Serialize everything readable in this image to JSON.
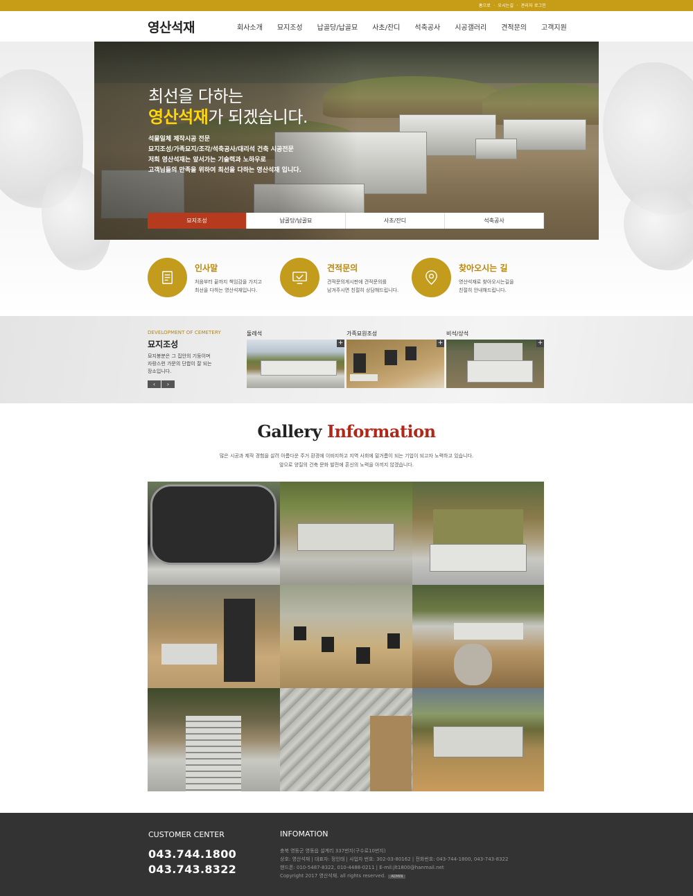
{
  "topbar": {
    "links": [
      "홈으로",
      "오시는길",
      "관리자 로그인"
    ],
    "separator": "·"
  },
  "header": {
    "logo": "영산석재",
    "nav": [
      "회사소개",
      "묘지조성",
      "납골당/납골묘",
      "사초/잔디",
      "석축공사",
      "시공갤러리",
      "견적문의",
      "고객지원"
    ]
  },
  "hero": {
    "headline_1": "최선을 다하는",
    "headline_accent": "영산석재",
    "headline_2_rest": "가 되겠습니다.",
    "desc": [
      "석물일체 제작시공 전문",
      "묘지조성/가족묘지/조각/석축공사/대리석 건축 시공전문",
      "저희 영산석재는 앞서가는 기술력과 노하우로",
      "고객님들의 만족을 위하여 최선을 다하는 영산석재 입니다."
    ],
    "tabs": [
      "묘지조성",
      "납골당/납골묘",
      "사초/잔디",
      "석축공사"
    ]
  },
  "features": [
    {
      "title": "인사말",
      "desc": [
        "처음부터 끝까지 책임감을 가지고",
        "최선을 다하는 영산석재입니다."
      ],
      "icon": "document-icon"
    },
    {
      "title": "견적문의",
      "desc": [
        "견적문의게시판에 견적문의를",
        "남겨주시면 친절히 상담해드립니다."
      ],
      "icon": "monitor-check-icon"
    },
    {
      "title": "찾아오시는 길",
      "desc": [
        "영산석재로 찾아오시는길을",
        "친절히 안내해드립니다."
      ],
      "icon": "location-pin-icon"
    }
  ],
  "cemetery": {
    "sub": "DEVELOPMENT OF CEMETERY",
    "title": "묘지조성",
    "text": [
      "묘지봉분은 그 집안의 기둥이며",
      "자랑스런 가문의 단합이 잘 되는",
      "장소입니다."
    ],
    "prev": "‹",
    "next": "›",
    "plus": "+",
    "items": [
      "둘레석",
      "가족묘원조성",
      "비석/상석"
    ]
  },
  "gallery": {
    "title_1": "Gallery",
    "title_2": "Information",
    "desc": [
      "많은 시공과 제작 경험을 살려 아름다운 주거 환경에 이바지하고 지역 사회에 밑거름이 되는 기업이 되고자 노력하고 있습니다.",
      "앞으로 양질의 건축 문화 발전에 혼신의 노력을 아끼지 않겠습니다."
    ]
  },
  "footer": {
    "cc_title": "CUSTOMER CENTER",
    "tel_1": "043.744.1800",
    "tel_2": "043.743.8322",
    "info_title": "INFOMATION",
    "lines": [
      "충북 영동군 영동읍 설계리 337번지(구수로10번지)",
      "상호: 영산석재 | 대표자: 정인태 | 사업자 번호: 302-03-80162 | 전화번호: 043-744-1800, 043-743-8322",
      "핸드폰: 010-5487-8322, 010-4488-0211 | E-mil:jlt1800@hanmail.net",
      "Copyright 2017 영산석재. all rights reserved."
    ],
    "admin": "ADMIN"
  },
  "colors": {
    "gold": "#c79d17",
    "red": "#b53a1e",
    "dark": "#333333"
  }
}
